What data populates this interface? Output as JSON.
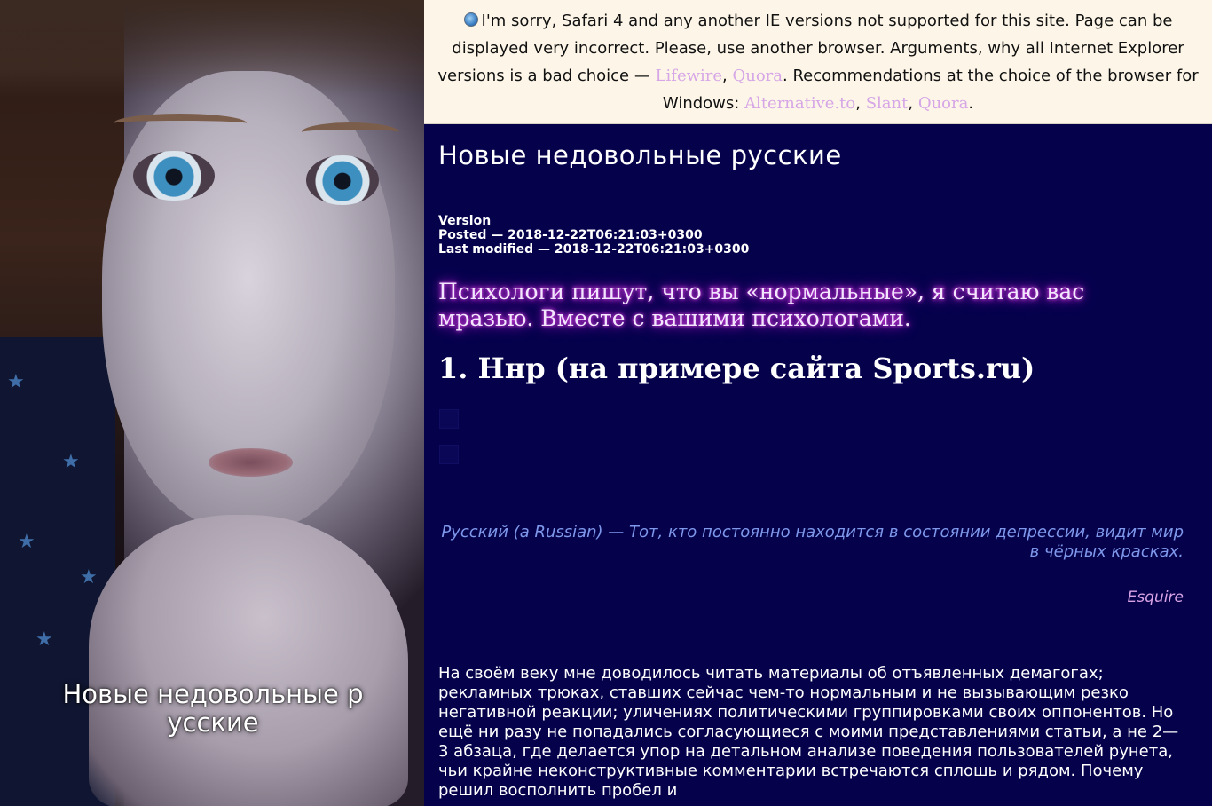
{
  "photo": {
    "caption_title": "Новые недовольные р усские"
  },
  "notice": {
    "icon": "globe-icon",
    "text_1": "I'm sorry, Safari 4 and any another IE versions not supported for this site. Page can be displayed very incorrect. Please, use another browser. Arguments, why all Internet Explorer versions is a bad choice — ",
    "link_lifewire": "Lifewire",
    "sep_1": ", ",
    "link_quora_1": "Quora",
    "text_2": ". Recommendations at the choice of the browser for Windows: ",
    "link_alternativeto": "Alternative.to",
    "sep_2": ", ",
    "link_slant": "Slant",
    "sep_3": ", ",
    "link_quora_2": "Quora",
    "text_3": ".",
    "link_color": "#d6a6e6",
    "background": "#fdf6e8"
  },
  "main": {
    "site_title": "Новые недовольные русские",
    "meta": {
      "version": "Version",
      "posted": "Posted — 2018-12-22T06:21:03+0300",
      "modified": "Last modified — 2018-12-22T06:21:03+0300"
    },
    "lead": "Психологи пишут, что вы «нормальные», я считаю вас мразью. Вместе с вашими психологами.",
    "heading": "1. Ннр (на примере сайта Sports.ru)",
    "quote": "Русский (a Russian) — Тот, кто постоянно находится в состоянии депрессии, видит мир в чёрных красках.",
    "quote_source": "Esquire",
    "body": "На своём веку мне доводилось читать материалы об отъявленных демагогах; рекламных трюках, ставших сейчас чем-то нормальным и не вызывающим резко негативной реакции; уличениях политическими группировками своих оппонентов. Но ещё ни разу не попадались согласующиеся с моими представлениями статьи, а не 2—3 абзаца, где делается упор на детальном анализе поведения пользователей рунета, чьи крайне неконструктивные комментарии встречаются сплошь и рядом. Почему решил восполнить пробел и",
    "background": "#05024b",
    "lead_glow_color": "#c22bd8",
    "quote_color": "#7f98ec",
    "quote_source_color": "#d9a4e6"
  }
}
